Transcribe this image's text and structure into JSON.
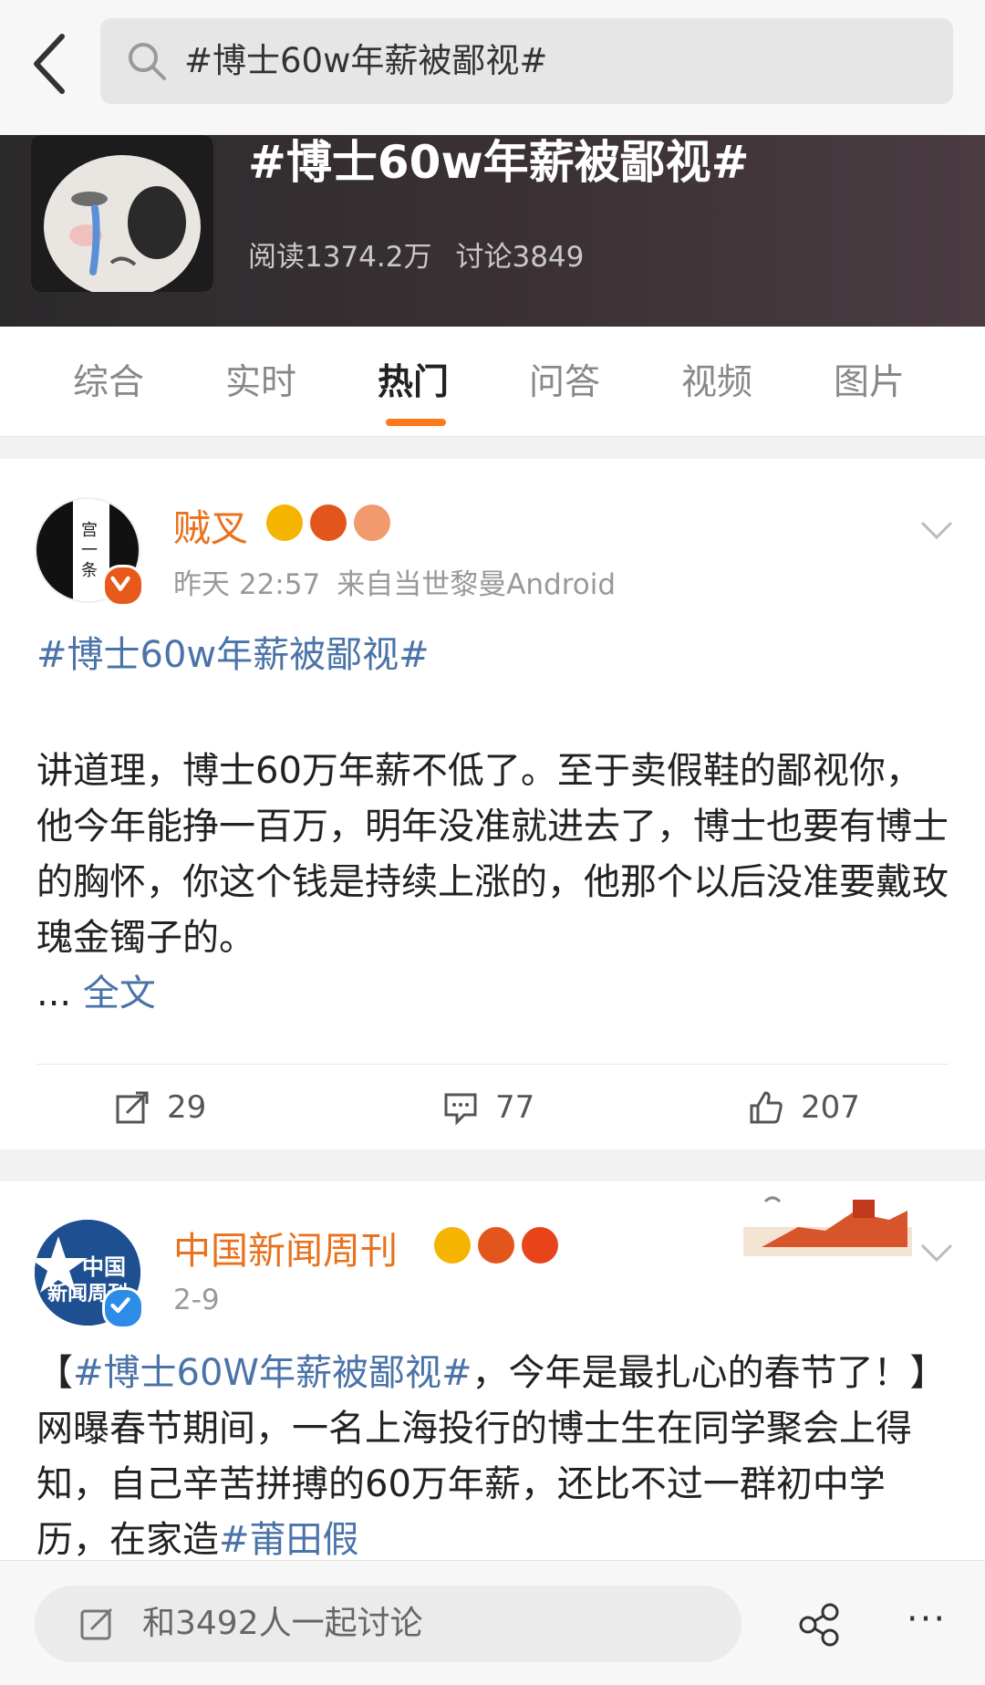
{
  "search": {
    "query": "#博士60w年薪被鄙视#"
  },
  "topic": {
    "title": "#博士60w年薪被鄙视#",
    "reads": "阅读1374.2万",
    "discussions": "讨论3849"
  },
  "tabs": [
    {
      "label": "综合"
    },
    {
      "label": "实时"
    },
    {
      "label": "热门",
      "active": true
    },
    {
      "label": "问答"
    },
    {
      "label": "视频"
    },
    {
      "label": "图片"
    }
  ],
  "posts": [
    {
      "username": "贼叉",
      "time": "昨天 22:57",
      "source": "来自当世黎曼Android",
      "hashtag": "#博士60w年薪被鄙视#",
      "body": "讲道理，博士60万年薪不低了。至于卖假鞋的鄙视你，他今年能挣一百万，明年没准就进去了，博士也要有博士的胸怀，你这个钱是持续上涨的，他那个以后没准要戴玫瑰金镯子的。",
      "ellipsis": "...",
      "full_text": "全文",
      "reposts": "29",
      "comments": "77",
      "likes": "207"
    },
    {
      "username": "中国新闻周刊",
      "avatar_text_1": "中国",
      "avatar_text_2": "新闻周刊",
      "time": "2-9",
      "body_open": "【",
      "body_hashtag": "#博士60W年薪被鄙视#",
      "body_rest": "，今年是最扎心的春节了！】网曝春节期间，一名上海投行的博士生在同学聚会上得知，自己辛苦拼搏的60万年薪，还比不过一群初中学历，在家造",
      "body_hashtag2": "#莆田假"
    }
  ],
  "bottom": {
    "discuss_placeholder": "和3492人一起讨论",
    "more": "···"
  },
  "colors": {
    "accent": "#ff7a1a",
    "link": "#4a73a8",
    "username": "#e8721e"
  }
}
